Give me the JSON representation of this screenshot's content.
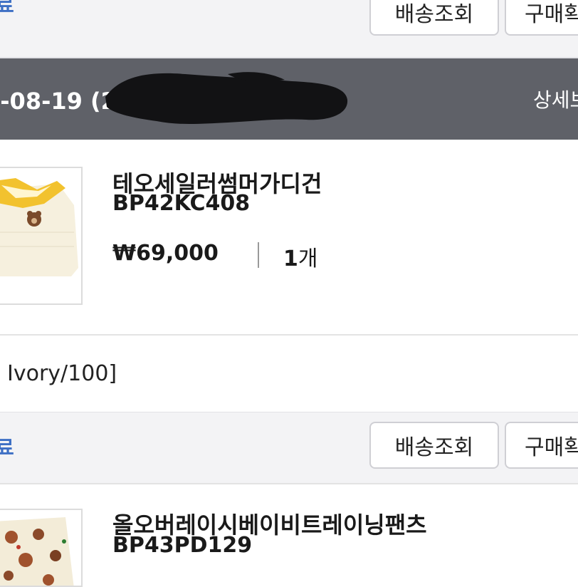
{
  "orders": [
    {
      "status": "료",
      "buttons": {
        "track": "배송조회",
        "confirm": "구매확"
      }
    },
    {
      "status": "료",
      "buttons": {
        "track": "배송조회",
        "confirm": "구매확"
      }
    }
  ],
  "order_header": {
    "date": "4-08-19 (2",
    "detail_link": "상세보"
  },
  "products": [
    {
      "name": "테오세일러썸머가디건",
      "code": "BP42KC408",
      "price": "₩69,000",
      "qty_number": "1",
      "qty_unit": "개",
      "option": "Ivory/100]"
    },
    {
      "name": "올오버레이시베이비트레이닝팬츠",
      "code": "BP43PD129"
    }
  ],
  "colors": {
    "status_blue": "#3d6fc4",
    "header_dark": "#5f6168",
    "panel_grey": "#f3f3f5"
  }
}
